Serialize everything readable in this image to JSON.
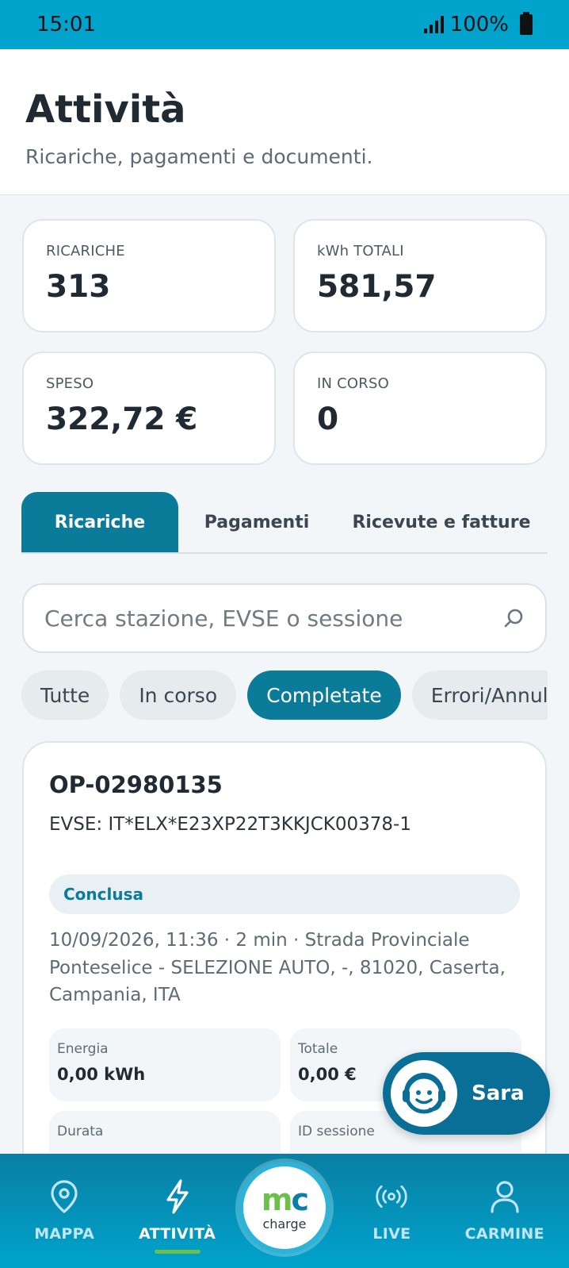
{
  "status_bar": {
    "time": "15:01",
    "battery": "100%"
  },
  "header": {
    "title": "Attività",
    "subtitle": "Ricariche, pagamenti e documenti."
  },
  "stats": [
    {
      "label": "RICARICHE",
      "value": "313"
    },
    {
      "label": "kWh TOTALI",
      "value": "581,57"
    },
    {
      "label": "SPESO",
      "value": "322,72 €"
    },
    {
      "label": "IN CORSO",
      "value": "0"
    }
  ],
  "tabs": [
    {
      "label": "Ricariche",
      "active": true
    },
    {
      "label": "Pagamenti",
      "active": false
    },
    {
      "label": "Ricevute e fatture",
      "active": false
    }
  ],
  "search": {
    "placeholder": "Cerca stazione, EVSE o sessione"
  },
  "filters": [
    {
      "label": "Tutte",
      "active": false
    },
    {
      "label": "In corso",
      "active": false
    },
    {
      "label": "Completate",
      "active": true
    },
    {
      "label": "Errori/Annullate",
      "active": false
    }
  ],
  "session_card": {
    "id": "OP-02980135",
    "evse": "EVSE: IT*ELX*E23XP22T3KKJCK00378-1",
    "status": "Conclusa",
    "description": "10/09/2026, 11:36 · 2 min · Strada Provinciale Ponteselice - SELEZIONE AUTO, -, 81020, Caserta, Campania, ITA",
    "metrics": [
      {
        "label": "Energia",
        "value": "0,00 kWh"
      },
      {
        "label": "Totale",
        "value": "0,00 €"
      },
      {
        "label": "Durata",
        "value": ""
      },
      {
        "label": "ID sessione",
        "value": ""
      }
    ]
  },
  "assistant": {
    "label": "Sara"
  },
  "bottom_nav": {
    "items": [
      {
        "label": "MAPPA",
        "icon": "map-pin-icon"
      },
      {
        "label": "ATTIVITÀ",
        "icon": "lightning-icon"
      },
      {
        "label": "LIVE",
        "icon": "broadcast-icon"
      },
      {
        "label": "CARMINE",
        "icon": "user-icon"
      }
    ],
    "logo_sub": "charge"
  },
  "colors": {
    "primary": "#0a7b98",
    "status_bar": "#00a3cc",
    "accent_green": "#6cc04a"
  }
}
